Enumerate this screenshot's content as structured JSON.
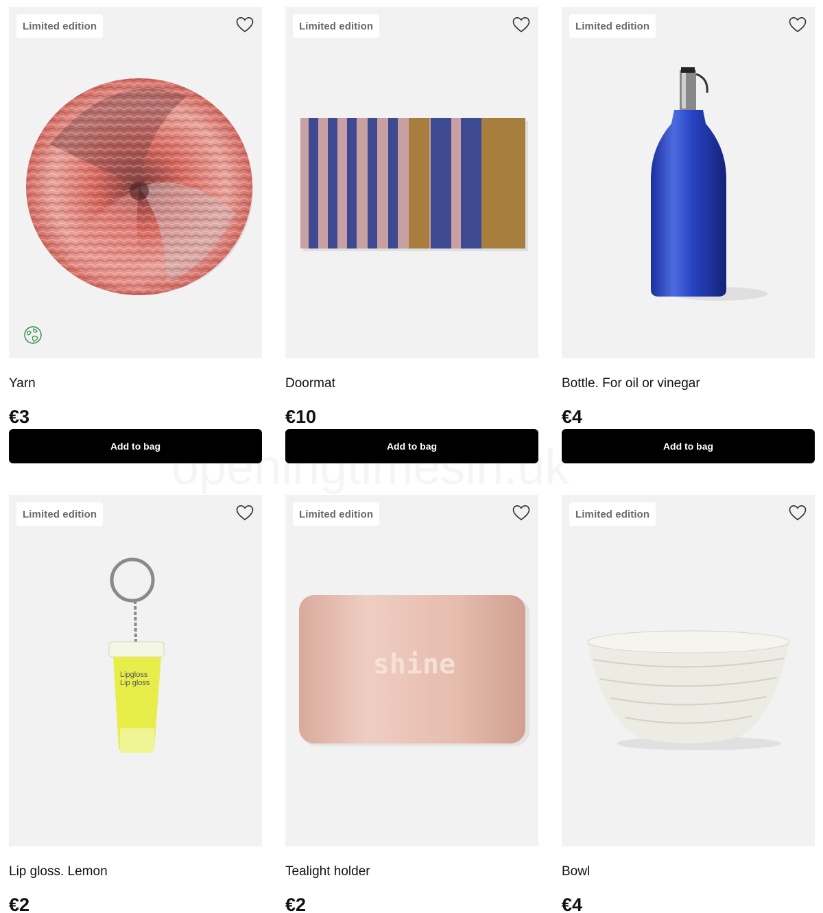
{
  "products": [
    {
      "badge": "Limited edition",
      "name": "Yarn",
      "price": "€3",
      "button": "Add to bag",
      "image_icon": "yarn-image",
      "eco_icon": "globe-icon"
    },
    {
      "badge": "Limited edition",
      "name": "Doormat",
      "price": "€10",
      "button": "Add to bag",
      "image_icon": "doormat-image"
    },
    {
      "badge": "Limited edition",
      "name": "Bottle. For oil or vinegar",
      "price": "€4",
      "button": "Add to bag",
      "image_icon": "bottle-image"
    },
    {
      "badge": "Limited edition",
      "name": "Lip gloss. Lemon",
      "price": "€2",
      "image_icon": "lip-gloss-keyring-image",
      "label_line1": "Lipgloss",
      "label_line2": "Lip gloss"
    },
    {
      "badge": "Limited edition",
      "name": "Tealight holder",
      "price": "€2",
      "image_icon": "tealight-holder-image",
      "print": "shine"
    },
    {
      "badge": "Limited edition",
      "name": "Bowl",
      "price": "€4",
      "image_icon": "bowl-image"
    }
  ],
  "watermark": "openingtimesin.uk",
  "colors": {
    "card_bg": "#f2f2f2",
    "button_bg": "#000000",
    "button_text": "#ffffff",
    "badge_text": "#6a6a6a"
  }
}
